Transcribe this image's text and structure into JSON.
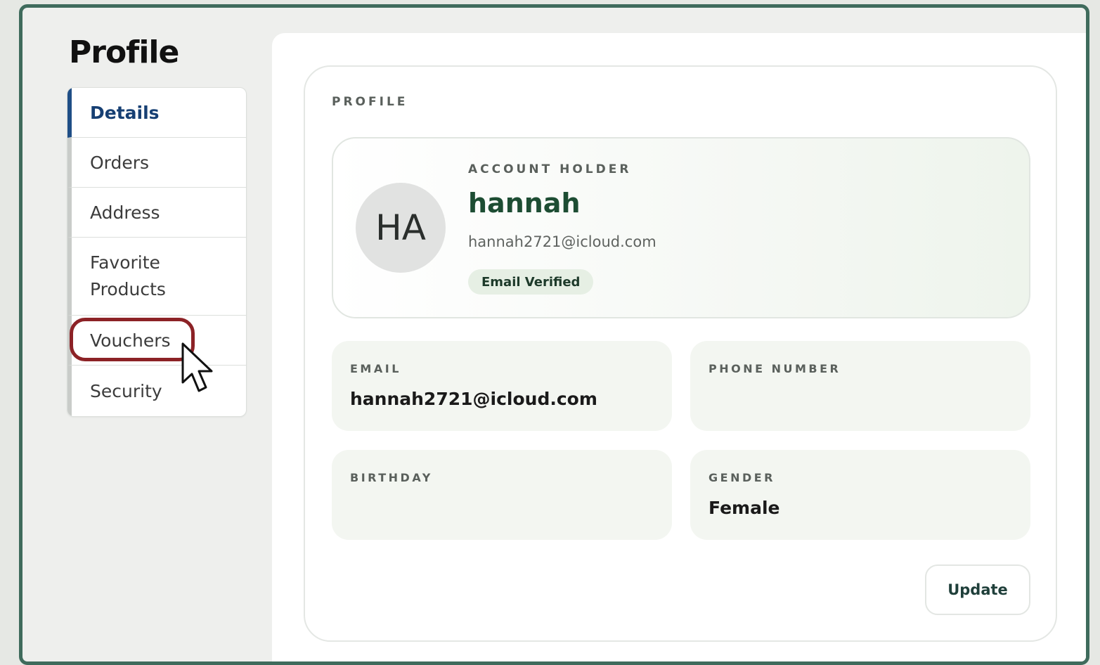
{
  "page": {
    "title": "Profile"
  },
  "sidebar": {
    "items": [
      {
        "label": "Details",
        "active": true
      },
      {
        "label": "Orders",
        "active": false
      },
      {
        "label": "Address",
        "active": false
      },
      {
        "label": "Favorite Products",
        "active": false
      },
      {
        "label": "Vouchers",
        "active": false,
        "highlighted": true
      },
      {
        "label": "Security",
        "active": false
      }
    ]
  },
  "profile": {
    "section_label": "PROFILE",
    "holder_label": "ACCOUNT HOLDER",
    "avatar_initials": "HA",
    "name": "hannah",
    "email": "hannah2721@icloud.com",
    "badge": "Email Verified"
  },
  "fields": {
    "email": {
      "label": "EMAIL",
      "value": "hannah2721@icloud.com"
    },
    "phone": {
      "label": "PHONE NUMBER",
      "value": ""
    },
    "birthday": {
      "label": "BIRTHDAY",
      "value": ""
    },
    "gender": {
      "label": "GENDER",
      "value": "Female"
    }
  },
  "actions": {
    "update_label": "Update"
  },
  "colors": {
    "frame_border": "#3f6b5c",
    "active_nav": "#1f4e86",
    "name_green": "#1d4d33",
    "highlight_ring": "#8c2226"
  },
  "icons": {
    "cursor": "mouse-pointer-icon"
  }
}
